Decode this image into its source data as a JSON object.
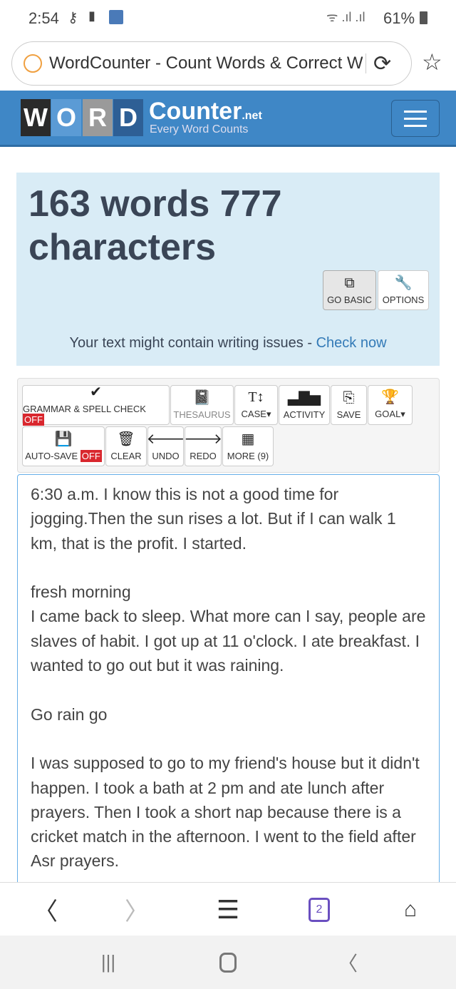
{
  "status_bar": {
    "time": "2:54",
    "battery": "61%"
  },
  "browser": {
    "page_title": "WordCounter - Count Words & Correct W"
  },
  "header": {
    "logo_letters": [
      "W",
      "O",
      "R",
      "D"
    ],
    "logo_word": "Counter",
    "logo_tld": ".net",
    "tagline": "Every Word Counts",
    "brand_color": "#3f87c6"
  },
  "counter": {
    "summary": "163 words 777 characters",
    "go_basic": "GO BASIC",
    "options": "OPTIONS",
    "issues_text": "Your text might contain writing issues - ",
    "issues_link": "Check now"
  },
  "toolbar": {
    "grammar": "GRAMMAR & SPELL CHECK",
    "grammar_state": "OFF",
    "thesaurus": "THESAURUS",
    "case": "CASE",
    "activity": "ACTIVITY",
    "save": "SAVE",
    "goal": "GOAL",
    "autosave": "AUTO-SAVE",
    "autosave_state": "OFF",
    "clear": "CLEAR",
    "undo": "UNDO",
    "redo": "REDO",
    "more": "MORE (9)"
  },
  "editor": {
    "text": "6:30 a.m. I know this is not a good time for jogging.Then the sun rises a lot. But if I can walk 1 km, that is the profit. I started.\n\nfresh morning\nI came back to sleep. What more can I say, people are slaves of habit. I got up at 11 o'clock. I ate breakfast. I wanted to go out but it was raining.\n\nGo rain go\n\nI was supposed to go to my friend's house but it didn't happen. I took a bath at 2 pm and ate lunch after prayers. Then I took a short nap because there is a cricket match in the afternoon. I went to the field after Asr prayers."
  },
  "bottom_nav": {
    "tabs_count": "2"
  }
}
